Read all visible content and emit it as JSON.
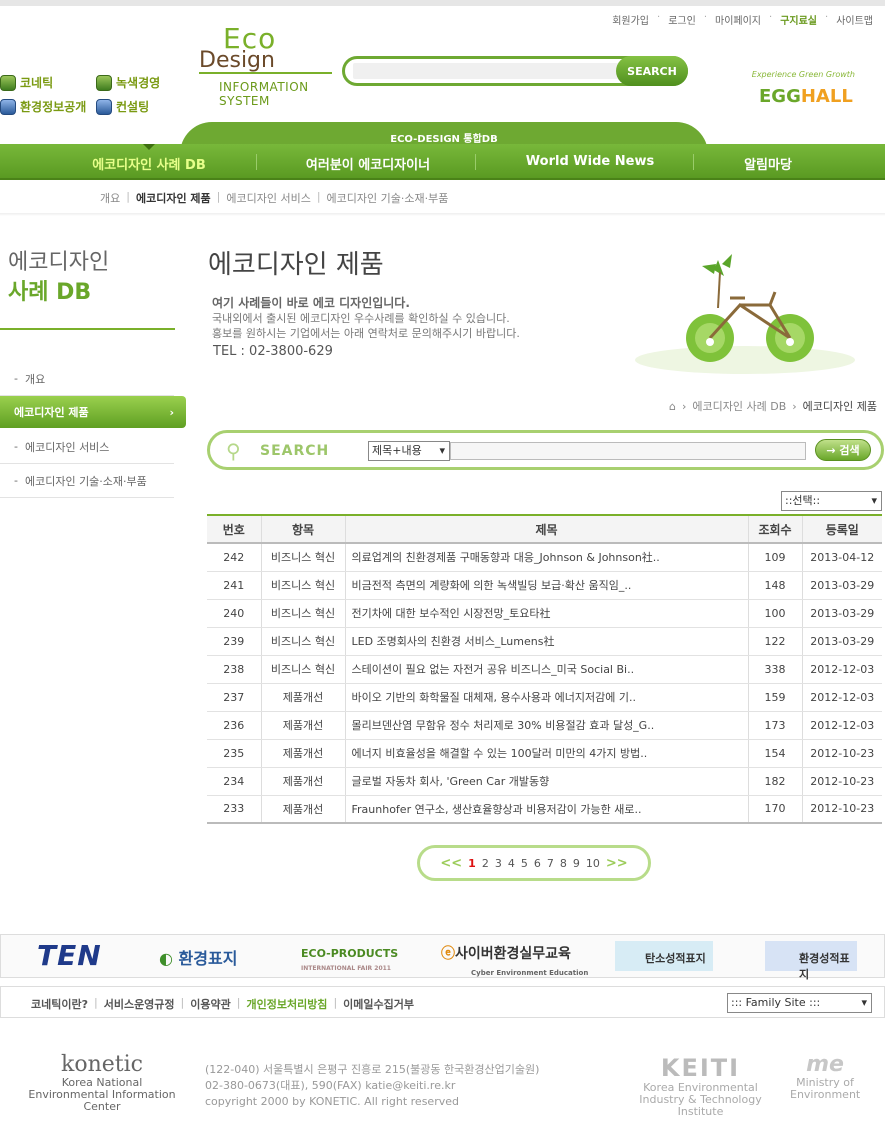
{
  "util_links": [
    "회원가입",
    "로그인",
    "마이페이지",
    "구지료실",
    "사이트맵"
  ],
  "quick_links": [
    "코네틱",
    "녹색경영",
    "환경정보공개",
    "컨설팅"
  ],
  "logo": {
    "line1": "Eco",
    "line2": "Design",
    "line3": "INFORMATION",
    "line4": "SYSTEM"
  },
  "search_button": "SEARCH",
  "egg_hall": {
    "tagline": "Experience Green Growth",
    "brand_a": "EGG",
    "brand_b": "HALL"
  },
  "gnb_caption": "ECO-DESIGN 통합DB",
  "gnb_menu": [
    "에코디자인 사례 DB",
    "여러분이 에코디자이너",
    "World Wide News",
    "알림마당"
  ],
  "sub_menu": [
    "개요",
    "에코디자인 제품",
    "에코디자인 서비스",
    "에코디자인 기술·소재·부품"
  ],
  "lnb_title": {
    "line1": "에코디자인",
    "line2": "사례 DB"
  },
  "lnb_items": [
    "개요",
    "에코디자인 제품",
    "에코디자인 서비스",
    "에코디자인 기술·소재·부품"
  ],
  "page_title": "에코디자인 제품",
  "intro": {
    "line1": "여기 사례들이 바로 에코 디자인입니다.",
    "line2": "국내외에서 출시된 에코디자인 우수사례를 확인하실 수 있습니다.",
    "line3": "홍보를 원하시는 기업에서는 아래 연락처로 문의해주시기 바랍니다.",
    "tel": "TEL : 02-3800-629"
  },
  "breadcrumb": [
    "에코디자인 사례 DB",
    "에코디자인 제품"
  ],
  "search_box": {
    "label": "SEARCH",
    "select_value": "제목+내용",
    "button": "검색"
  },
  "category_select": "::선택::",
  "table": {
    "headers": [
      "번호",
      "항목",
      "제목",
      "조회수",
      "등록일"
    ],
    "rows": [
      [
        "242",
        "비즈니스 혁신",
        "의료업계의 친환경제품 구매동향과 대응_Johnson & Johnson社..",
        "109",
        "2013-04-12"
      ],
      [
        "241",
        "비즈니스 혁신",
        "비금전적 측면의 계량화에 의한 녹색빌딩 보급·확산 움직임_..",
        "148",
        "2013-03-29"
      ],
      [
        "240",
        "비즈니스 혁신",
        "전기차에 대한 보수적인 시장전망_토요타社",
        "100",
        "2013-03-29"
      ],
      [
        "239",
        "비즈니스 혁신",
        "LED 조명회사의 친환경 서비스_Lumens社",
        "122",
        "2013-03-29"
      ],
      [
        "238",
        "비즈니스 혁신",
        "스테이션이 필요 없는 자전거 공유 비즈니스_미국 Social Bi..",
        "338",
        "2012-12-03"
      ],
      [
        "237",
        "제품개선",
        "바이오 기반의 화학물질 대체재, 용수사용과 에너지저감에 기..",
        "159",
        "2012-12-03"
      ],
      [
        "236",
        "제품개선",
        "몰리브덴산염 무함유 정수 처리제로 30% 비용절감 효과 달성_G..",
        "173",
        "2012-12-03"
      ],
      [
        "235",
        "제품개선",
        "에너지 비효율성을 해결할 수 있는 100달러 미만의 4가지 방법..",
        "154",
        "2012-10-23"
      ],
      [
        "234",
        "제품개선",
        "글로벌 자동차 회사, 'Green Car 개발동향",
        "182",
        "2012-10-23"
      ],
      [
        "233",
        "제품개선",
        "Fraunhofer 연구소, 생산효율향상과 비용저감이 가능한 새로..",
        "170",
        "2012-10-23"
      ]
    ]
  },
  "pager": {
    "prev": "<<",
    "pages": [
      "1",
      "2",
      "3",
      "4",
      "5",
      "6",
      "7",
      "8",
      "9",
      "10"
    ],
    "next": ">>",
    "current": "1"
  },
  "banners": [
    "TEN",
    "환경표지",
    "ECO-PRODUCTS",
    "사이버환경실무교육",
    "탄소성적표지",
    "환경성적표지"
  ],
  "banner_sub": {
    "eco_products": "INTERNATIONAL FAIR 2011",
    "cyber": "Cyber Environment Education"
  },
  "footer_links": [
    "코네틱이란?",
    "서비스운영규정",
    "이용약관",
    "개인정보처리방침",
    "이메일수집거부"
  ],
  "family_site": "::: Family Site :::",
  "konetic": {
    "logo": "konetic",
    "line1": "Korea National",
    "line2": "Environmental Information Center"
  },
  "address": {
    "line1": "(122-040) 서울특별시 은평구 진흥로 215(불광동 한국환경산업기술원)",
    "line2": "02-380-0673(대표), 590(FAX) katie@keiti.re.kr",
    "line3": "copyright 2000 by KONETIC. All right reserved"
  },
  "keiti": {
    "logo": "KEITI",
    "line1": "Korea Environmental",
    "line2": "Industry & Technology Institute"
  },
  "moe": {
    "logo": "me",
    "line1": "Ministry of",
    "line2": "Environment"
  },
  "colors": {
    "accent": "#6ea932",
    "accent_dark": "#4a8218",
    "current_page": "#dd1111"
  }
}
